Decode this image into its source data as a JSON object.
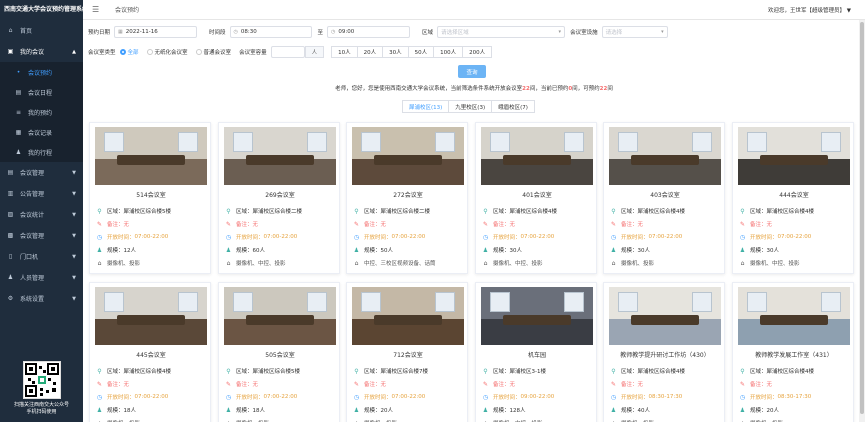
{
  "sidebar": {
    "logo": "西南交通大学会议预约管理系统",
    "items": [
      {
        "label": "首页",
        "icon": "home-icon",
        "arrow": ""
      },
      {
        "label": "我的会议",
        "icon": "meeting-icon",
        "arrow": "▲"
      },
      {
        "label": "会议管理",
        "icon": "manage-icon",
        "arrow": "▼"
      },
      {
        "label": "公告管理",
        "icon": "notice-icon",
        "arrow": "▼"
      },
      {
        "label": "会议统计",
        "icon": "stats-icon",
        "arrow": "▼"
      },
      {
        "label": "会议管理",
        "icon": "settings-icon",
        "arrow": "▼"
      },
      {
        "label": "门口机",
        "icon": "door-icon",
        "arrow": "▼"
      },
      {
        "label": "人员管理",
        "icon": "people-icon",
        "arrow": "▼"
      },
      {
        "label": "系统设置",
        "icon": "system-icon",
        "arrow": "▼"
      }
    ],
    "subitems": [
      {
        "label": "会议预约",
        "icon": "dot-icon"
      },
      {
        "label": "会议日程",
        "icon": "calendar-icon"
      },
      {
        "label": "我的预约",
        "icon": "list-icon"
      },
      {
        "label": "会议记录",
        "icon": "record-icon"
      },
      {
        "label": "我的行程",
        "icon": "person-icon"
      }
    ],
    "qr_text_1": "扫描关注西南交大公众号",
    "qr_text_2": "手机扫码使用"
  },
  "header": {
    "breadcrumb": "会议预约",
    "user": "欢迎您，王世军【超级管理员】",
    "user_arrow": "▼"
  },
  "filters": {
    "date_label": "预约日期",
    "date_value": "2022-11-16",
    "time_label": "时间段",
    "start_time": "08:30",
    "to_label": "至",
    "end_time": "09:00",
    "area_label": "区域",
    "area_placeholder": "请选择区域",
    "equip_label": "会议室设施",
    "equip_placeholder": "请选择",
    "type_label": "会议室类型",
    "types": [
      "全部",
      "无纸化会议室",
      "普通会议室"
    ],
    "type_selected": 0,
    "scale_label": "会议室容量",
    "scale_unit": "人",
    "sizes": [
      "10人",
      "20人",
      "30人",
      "50人",
      "100人",
      "200人"
    ],
    "search_button": "查询"
  },
  "notice": {
    "p1": "老师，您好，您是使用西南交通大学会议系统，当前筛选条件系统开放会议室",
    "n1": "22",
    "p2": "间，当前已预约",
    "n2": "0",
    "p3": "间，可预约",
    "n3": "22",
    "p4": "间"
  },
  "tabs": [
    "犀浦校区(13)",
    "九里校区(3)",
    "峨眉校区(7)"
  ],
  "tab_active": 0,
  "card_labels": {
    "area": "区域：",
    "remark": "备注：",
    "hours": "开放时间：",
    "capacity": "规模："
  },
  "rooms": [
    {
      "name": "514会议室",
      "area": "犀浦校区综合楼5楼",
      "remark": "无",
      "hours": "07:00-22:00",
      "capacity": "12人",
      "equipment": "摄像机、投影",
      "colors": [
        "#cfc9bd",
        "#7b6a5a"
      ]
    },
    {
      "name": "269会议室",
      "area": "犀浦校区综合楼二楼",
      "remark": "无",
      "hours": "07:00-22:00",
      "capacity": "60人",
      "equipment": "摄像机、中控、投影",
      "colors": [
        "#d9d6cf",
        "#6b5e52"
      ]
    },
    {
      "name": "272会议室",
      "area": "犀浦校区综合楼二楼",
      "remark": "无",
      "hours": "07:00-22:00",
      "capacity": "50人",
      "equipment": "中控、三校区视频设备、话筒",
      "colors": [
        "#c9c0ae",
        "#5d4a3b"
      ]
    },
    {
      "name": "401会议室",
      "area": "犀浦校区综合楼4楼",
      "remark": "无",
      "hours": "07:00-22:00",
      "capacity": "30人",
      "equipment": "摄像机、中控、投影",
      "colors": [
        "#d6d3cb",
        "#4a4540"
      ]
    },
    {
      "name": "403会议室",
      "area": "犀浦校区综合楼4楼",
      "remark": "无",
      "hours": "07:00-22:00",
      "capacity": "30人",
      "equipment": "摄像机、投影",
      "colors": [
        "#dad7d0",
        "#55504a"
      ]
    },
    {
      "name": "444会议室",
      "area": "犀浦校区综合楼4楼",
      "remark": "无",
      "hours": "07:00-22:00",
      "capacity": "30人",
      "equipment": "摄像机、中控、投影",
      "colors": [
        "#e2e0da",
        "#3f3c38"
      ]
    },
    {
      "name": "445会议室",
      "area": "犀浦校区综合楼4楼",
      "remark": "无",
      "hours": "07:00-22:00",
      "capacity": "18人",
      "equipment": "摄像机、投影",
      "colors": [
        "#d7d4cd",
        "#5a4838"
      ]
    },
    {
      "name": "505会议室",
      "area": "犀浦校区综合楼5楼",
      "remark": "无",
      "hours": "07:00-22:00",
      "capacity": "18人",
      "equipment": "摄像机、投影",
      "colors": [
        "#ccc8be",
        "#6b5544"
      ]
    },
    {
      "name": "712会议室",
      "area": "犀浦校区综合楼7楼",
      "remark": "无",
      "hours": "07:00-22:00",
      "capacity": "20人",
      "equipment": "摄像机、投影",
      "colors": [
        "#c4b8a6",
        "#5b4532"
      ]
    },
    {
      "name": "机车园",
      "area": "犀浦校区3-1楼",
      "remark": "无",
      "hours": "09:00-22:00",
      "capacity": "128人",
      "equipment": "摄像机、中控、投影",
      "colors": [
        "#6a6f7a",
        "#3a3d44"
      ]
    },
    {
      "name": "教师教学提升研讨工作坊（430）",
      "area": "犀浦校区综合楼4楼",
      "remark": "无",
      "hours": "08:30-17:30",
      "capacity": "40人",
      "equipment": "摄像机、投影",
      "colors": [
        "#e6e4de",
        "#9aa5b3"
      ]
    },
    {
      "name": "教师教学发展工作室（431）",
      "area": "犀浦校区综合楼4楼",
      "remark": "无",
      "hours": "08:30-17:30",
      "capacity": "20人",
      "equipment": "摄像机、投影",
      "colors": [
        "#e4e1da",
        "#8ea0b0"
      ]
    }
  ]
}
